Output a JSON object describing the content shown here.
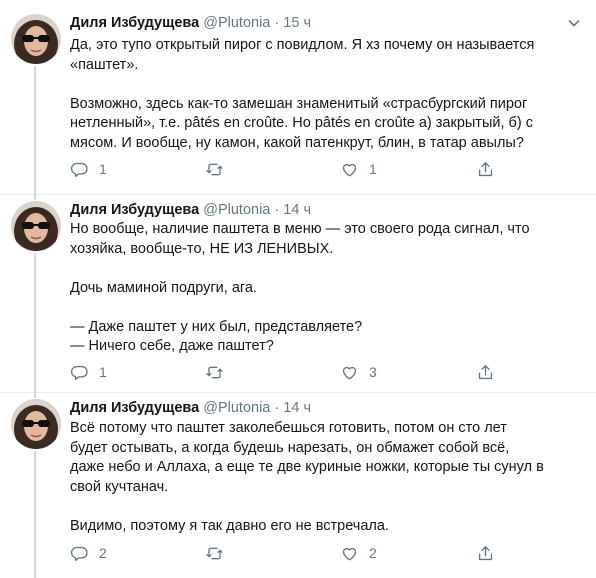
{
  "tweets": [
    {
      "name": "Диля Избудущева",
      "handle": "@Plutonia",
      "dot": "·",
      "time": "15 ч",
      "lines": [
        "Да, это тупо открытый пирог с повидлом. Я хз почему он называется",
        "«паштет».",
        "",
        "Возможно, здесь как-то замешан знаменитый «страсбургский пирог",
        "нетленный», т.е. pâtés en croûte.  Но pâtés en croûte а) закрытый, б) с",
        "мясом. И вообще, ну камон, какой патенкрут, блин, в татар авылы?"
      ],
      "replies": "1",
      "retweets": "",
      "likes": "1"
    },
    {
      "name": "Диля Избудущева",
      "handle": "@Plutonia",
      "dot": "·",
      "time": "14 ч",
      "lines": [
        "Но вообще, наличие паштета в меню — это своего рода сигнал, что",
        "хозяйка, вообще-то, НЕ ИЗ ЛЕНИВЫХ.",
        "",
        "Дочь маминой подруги, ага.",
        "",
        "— Даже паштет у них был, представляете?",
        "— Ничего себе, даже паштет?"
      ],
      "replies": "1",
      "retweets": "",
      "likes": "3"
    },
    {
      "name": "Диля Избудущева",
      "handle": "@Plutonia",
      "dot": "·",
      "time": "14 ч",
      "lines": [
        "Всё потому что паштет заколебешься готовить, потом он сто лет",
        "будет остывать, а когда будешь нарезать, он обмажет собой всё,",
        "даже небо и Аллаха, а еще те две куриные ножки, которые ты сунул в",
        "свой кучтанач.",
        "",
        "Видимо, поэтому я так давно его не встречала."
      ],
      "replies": "2",
      "retweets": "",
      "likes": "2"
    }
  ],
  "icons": {
    "reply": "reply-icon",
    "retweet": "retweet-icon",
    "like": "heart-icon",
    "share": "share-icon",
    "caret": "chevron-down-icon"
  },
  "colors": {
    "text": "#14171a",
    "muted": "#657786",
    "divider": "#e6ecf0",
    "thread_line": "#ccd6dd"
  }
}
